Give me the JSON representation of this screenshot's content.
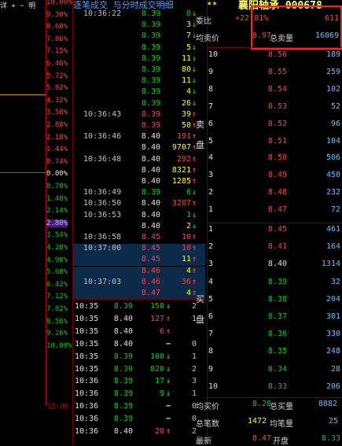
{
  "left_panel": {
    "top_controls": "详 + − 明",
    "percent_labels": [
      "10.00%",
      "9.30%",
      "8.60%",
      "7.86%",
      "7.15%",
      "6.46%",
      "5.72%",
      "5.02%",
      "4.32%",
      "3.58%",
      "2.88%",
      "2.18%",
      "1.44%",
      "0.74%",
      "0.00%",
      "0.70%",
      "1.40%",
      "2.14%",
      "2.80%",
      "3.54%",
      "4.28%",
      "4.98%",
      "5.68%",
      "6.42%",
      "7.12%",
      "7.82%",
      "8.56%",
      "9.26%",
      "10.00%"
    ],
    "time_label": "15:00"
  },
  "center_panel": {
    "title": "逐笔成交 与分时成交明细",
    "ticks": [
      {
        "time": "10:36:22",
        "price": "8.39",
        "vol": "8",
        "dir": "↓",
        "color": "g"
      },
      {
        "time": "",
        "price": "8.39",
        "vol": "3",
        "dir": "↓",
        "color": "g",
        "vcolor": "y"
      },
      {
        "time": "",
        "price": "8.39",
        "vol": "7",
        "dir": "↓",
        "color": "g",
        "vcolor": "y"
      },
      {
        "time": "",
        "price": "8.39",
        "vol": "5",
        "dir": "↓",
        "color": "g",
        "vcolor": "y"
      },
      {
        "time": "",
        "price": "8.39",
        "vol": "11",
        "dir": "↓",
        "color": "g",
        "vcolor": "y"
      },
      {
        "time": "",
        "price": "8.39",
        "vol": "80",
        "dir": "↓",
        "color": "g",
        "vcolor": "y"
      },
      {
        "time": "",
        "price": "8.39",
        "vol": "11",
        "dir": "↓",
        "color": "g",
        "vcolor": "y"
      },
      {
        "time": "",
        "price": "8.39",
        "vol": "4",
        "dir": "↓",
        "color": "g",
        "vcolor": "y"
      },
      {
        "time": "",
        "price": "8.39",
        "vol": "26",
        "dir": "↓",
        "color": "g",
        "vcolor": "y"
      },
      {
        "time": "10:36:43",
        "price": "8.39",
        "vol": "39",
        "dir": "↑",
        "color": "r",
        "vcolor": "y"
      },
      {
        "time": "",
        "price": "8.39",
        "vol": "50",
        "dir": "↑",
        "color": "r",
        "vcolor": "y"
      },
      {
        "time": "10:36:46",
        "price": "8.40",
        "vol": "191",
        "dir": "↑",
        "color": "r",
        "pcolor": "w"
      },
      {
        "time": "",
        "price": "8.40",
        "vol": "9707",
        "dir": "↑",
        "color": "r",
        "pcolor": "w",
        "vcolor": "y"
      },
      {
        "time": "10:36:48",
        "price": "8.40",
        "vol": "292",
        "dir": "↑",
        "color": "r",
        "pcolor": "w"
      },
      {
        "time": "",
        "price": "8.40",
        "vol": "8321",
        "dir": "↑",
        "color": "r",
        "pcolor": "w",
        "vcolor": "y"
      },
      {
        "time": "",
        "price": "8.40",
        "vol": "1285",
        "dir": "↑",
        "color": "r",
        "pcolor": "w",
        "vcolor": "y"
      },
      {
        "time": "10:36:49",
        "price": "8.39",
        "vol": "6",
        "dir": "↓",
        "color": "g"
      },
      {
        "time": "10:36:50",
        "price": "8.40",
        "vol": "3207",
        "dir": "↑",
        "color": "r",
        "pcolor": "w"
      },
      {
        "time": "10:36:53",
        "price": "8.40",
        "vol": "1",
        "dir": "↓",
        "color": "g",
        "pcolor": "w"
      },
      {
        "time": "",
        "price": "8.40",
        "vol": "2",
        "dir": "↓",
        "color": "g",
        "pcolor": "w",
        "vcolor": "y"
      },
      {
        "time": "10:36:58",
        "price": "8.45",
        "vol": "10",
        "dir": "↑",
        "color": "r"
      },
      {
        "time": "10:37:00",
        "price": "8.45",
        "vol": "10",
        "dir": "↑",
        "color": "r",
        "sel": true
      },
      {
        "time": "",
        "price": "8.45",
        "vol": "11",
        "dir": "↑",
        "color": "r",
        "sel": true,
        "vcolor": "y"
      },
      {
        "time": "",
        "price": "8.46",
        "vol": "4",
        "dir": "↑",
        "color": "r",
        "sel": true,
        "vcolor": "y"
      },
      {
        "time": "10:37:03",
        "price": "8.46",
        "vol": "36",
        "dir": "↑",
        "color": "r",
        "sel": true
      },
      {
        "time": "",
        "price": "8.47",
        "vol": "4",
        "dir": "↑",
        "color": "r",
        "sel": true,
        "vcolor": "y"
      }
    ],
    "minute_rows": [
      {
        "time": "10:35",
        "price": "8.39",
        "vol": "150",
        "arrow": "↓",
        "num": "2",
        "color": "g"
      },
      {
        "time": "10:35",
        "price": "8.40",
        "vol": "127",
        "arrow": "↑",
        "num": "1",
        "color": "r",
        "pcolor": "w"
      },
      {
        "time": "10:35",
        "price": "8.40",
        "vol": "6",
        "arrow": "↑",
        "num": "",
        "color": "r",
        "pcolor": "w"
      },
      {
        "time": "10:35",
        "price": "8.40",
        "vol": "",
        "arrow": "−",
        "num": "0",
        "color": "w",
        "pcolor": "w"
      },
      {
        "time": "10:35",
        "price": "8.39",
        "vol": "100",
        "arrow": "↓",
        "num": "1",
        "color": "g"
      },
      {
        "time": "10:35",
        "price": "8.39",
        "vol": "820",
        "arrow": "↓",
        "num": "2",
        "color": "g"
      },
      {
        "time": "10:36",
        "price": "8.39",
        "vol": "17",
        "arrow": "↓",
        "num": "3",
        "color": "g"
      },
      {
        "time": "10:36",
        "price": "8.39",
        "vol": "9",
        "arrow": "↓",
        "num": "1",
        "color": "g"
      },
      {
        "time": "10:36",
        "price": "8.39",
        "vol": "",
        "arrow": "−",
        "num": "0",
        "color": "w",
        "pcolor": "g"
      },
      {
        "time": "10:36",
        "price": "8.39",
        "vol": "",
        "arrow": "−",
        "num": "0",
        "color": "w",
        "pcolor": "g"
      },
      {
        "time": "10:36",
        "price": "8.40",
        "vol": "20",
        "arrow": "↑",
        "num": "2",
        "color": "r",
        "pcolor": "w"
      }
    ]
  },
  "right_panel": {
    "stars": "★★",
    "title": "襄阳轴承 000678",
    "weibi_label": "委比",
    "weibi_value": "+22.81%",
    "weibi_extra": "611",
    "avg_sell_label": "均卖价",
    "avg_sell_price": "8.97",
    "total_sell_label": "总卖量",
    "total_sell_value": "16069",
    "sell_side_label": "卖盘",
    "buy_side_label": "买盘",
    "asks": [
      {
        "lvl": "10",
        "price": "8.56",
        "vol": "189"
      },
      {
        "lvl": "9",
        "price": "8.55",
        "vol": "259"
      },
      {
        "lvl": "8",
        "price": "8.54",
        "vol": "102"
      },
      {
        "lvl": "7",
        "price": "8.53",
        "vol": "52"
      },
      {
        "lvl": "6",
        "price": "8.52",
        "vol": "96"
      },
      {
        "lvl": "5",
        "price": "8.51",
        "vol": "104"
      },
      {
        "lvl": "4",
        "price": "8.50",
        "vol": "506"
      },
      {
        "lvl": "3",
        "price": "8.49",
        "vol": "450"
      },
      {
        "lvl": "2",
        "price": "8.48",
        "vol": "232"
      },
      {
        "lvl": "1",
        "price": "8.47",
        "vol": "72"
      }
    ],
    "bids": [
      {
        "lvl": "1",
        "price": "8.45",
        "vol": "461",
        "color": "r"
      },
      {
        "lvl": "2",
        "price": "8.41",
        "vol": "164",
        "color": "r"
      },
      {
        "lvl": "3",
        "price": "8.40",
        "vol": "1314",
        "color": "w"
      },
      {
        "lvl": "4",
        "price": "8.39",
        "vol": "32",
        "color": "g"
      },
      {
        "lvl": "5",
        "price": "8.38",
        "vol": "204",
        "color": "g"
      },
      {
        "lvl": "6",
        "price": "8.37",
        "vol": "301",
        "color": "g"
      },
      {
        "lvl": "7",
        "price": "8.36",
        "vol": "330",
        "color": "g"
      },
      {
        "lvl": "8",
        "price": "8.35",
        "vol": "248",
        "color": "g"
      },
      {
        "lvl": "9",
        "price": "8.34",
        "vol": "28",
        "color": "g"
      },
      {
        "lvl": "10",
        "price": "8.33",
        "vol": "206",
        "color": "g"
      }
    ],
    "avg_buy_label": "均买价",
    "avg_buy_price": "8.28",
    "total_buy_label": "总买量",
    "total_buy_value": "8882",
    "total_trades_label": "总笔数",
    "total_trades_value": "1472",
    "avg_per_trade_label": "均笔量",
    "avg_per_trade_value": "25",
    "latest_label": "最新",
    "latest_price": "8.47",
    "open_label": "开盘",
    "open_price": "8.33"
  },
  "colors": {
    "up": "#ff4040",
    "down": "#00d000",
    "highlight_box": "#ff2020",
    "selection": "#0c2a4a"
  }
}
